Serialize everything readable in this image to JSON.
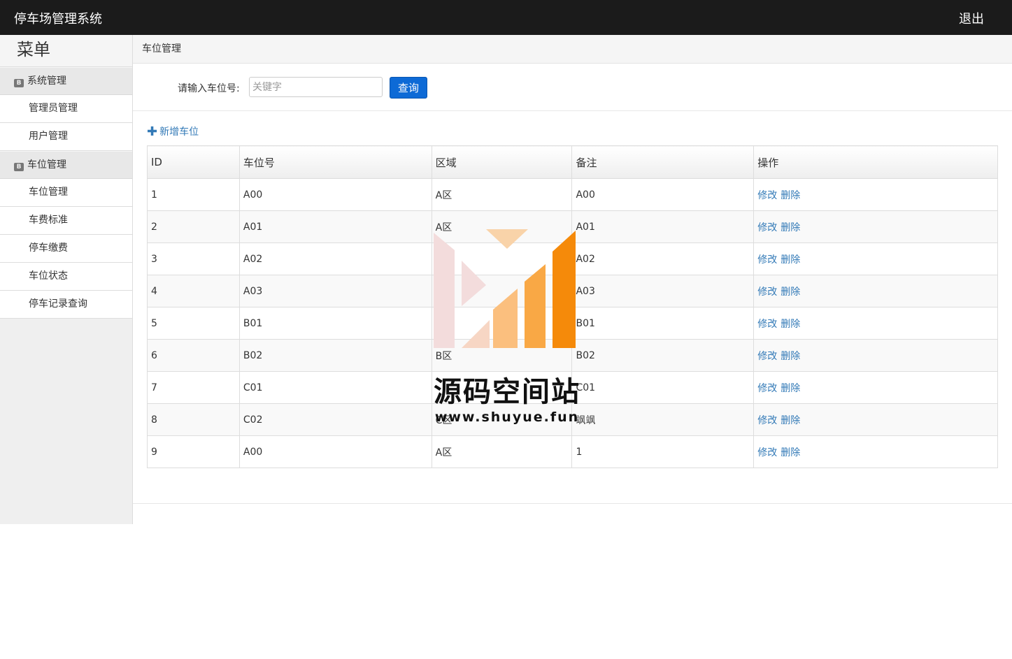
{
  "header": {
    "title": "停车场管理系统",
    "logout": "退出"
  },
  "sidebar": {
    "title": "菜单",
    "groups": [
      {
        "label": "系统管理",
        "items": [
          "管理员管理",
          "用户管理"
        ]
      },
      {
        "label": "车位管理",
        "items": [
          "车位管理",
          "车费标准",
          "停车缴费",
          "车位状态",
          "停车记录查询"
        ]
      }
    ]
  },
  "breadcrumb": "车位管理",
  "search": {
    "label": "请输入车位号:",
    "placeholder": "关键字",
    "button": "查询"
  },
  "add_label": "新增车位",
  "table": {
    "headers": [
      "ID",
      "车位号",
      "区域",
      "备注",
      "操作"
    ],
    "rows": [
      [
        "1",
        "A00",
        "A区",
        "A00"
      ],
      [
        "2",
        "A01",
        "A区",
        "A01"
      ],
      [
        "3",
        "A02",
        "",
        "A02"
      ],
      [
        "4",
        "A03",
        "",
        "A03"
      ],
      [
        "5",
        "B01",
        "",
        "B01"
      ],
      [
        "6",
        "B02",
        "B区",
        "B02"
      ],
      [
        "7",
        "C01",
        "",
        "C01"
      ],
      [
        "8",
        "C02",
        "C区",
        "飒飒"
      ],
      [
        "9",
        "A00",
        "A区",
        "1"
      ]
    ],
    "ops": {
      "edit": "修改",
      "delete": "删除"
    }
  },
  "watermark": {
    "name": "源码空间站",
    "url": "www.shuyue.fun"
  },
  "colors": {
    "topbar": "#1b1b1b",
    "primary_button": "#0d6ad6",
    "link": "#337ab7"
  }
}
